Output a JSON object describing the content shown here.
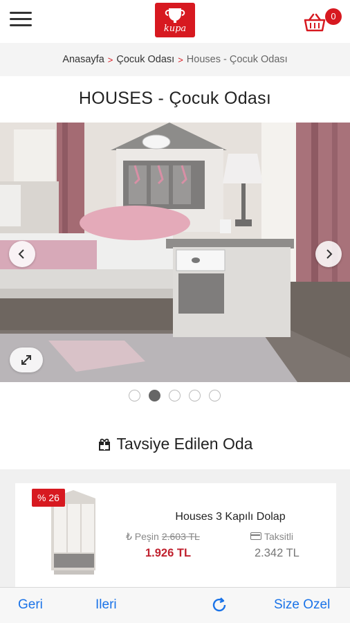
{
  "header": {
    "logo_text": "kupa",
    "cart_count": "0"
  },
  "breadcrumb": {
    "items": [
      "Anasayfa",
      "Çocuk Odası"
    ],
    "current": "Houses - Çocuk Odası"
  },
  "page_title": "HOUSES - Çocuk Odası",
  "gallery": {
    "slide_count": 5,
    "active_index": 1
  },
  "recommended": {
    "title": "Tavsiye Edilen Oda",
    "product": {
      "discount": "% 26",
      "name": "Houses 3 Kapılı Dolap",
      "pesin_label": "₺ Peşin",
      "old_price": "2.603 TL",
      "price": "1.926 TL",
      "taksit_label": "Taksitli",
      "taksit_price": "2.342 TL"
    }
  },
  "toolbar": {
    "back": "Geri",
    "forward": "Ileri",
    "custom": "Size Ozel"
  },
  "colors": {
    "brand": "#d71920",
    "link": "#1a73e8"
  }
}
